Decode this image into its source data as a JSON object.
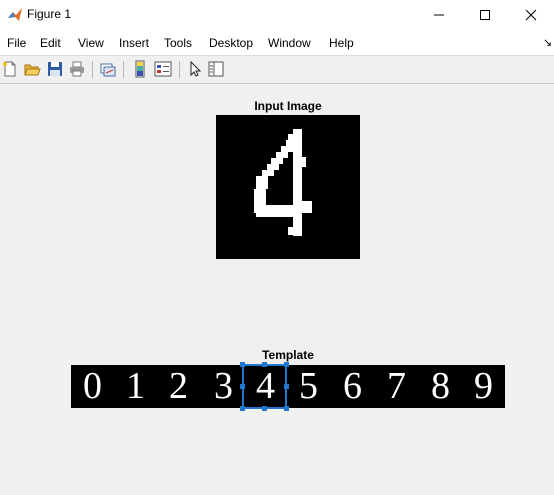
{
  "window": {
    "title": "Figure 1",
    "icons": {
      "app": "matlab-icon",
      "minimize": "minimize-icon",
      "maximize": "maximize-icon",
      "close": "close-icon"
    }
  },
  "menu": {
    "items": [
      "File",
      "Edit",
      "View",
      "Insert",
      "Tools",
      "Desktop",
      "Window",
      "Help"
    ],
    "dock_arrow": "↘"
  },
  "toolbar": {
    "icons": [
      "new-figure-icon",
      "open-file-icon",
      "save-icon",
      "print-icon",
      "link-plot-icon",
      "insert-colorbar-icon",
      "insert-legend-icon",
      "edit-plot-icon",
      "plot-browser-icon"
    ]
  },
  "axes": {
    "input_title": "Input Image",
    "template_title": "Template",
    "template_digits": [
      "0",
      "1",
      "2",
      "3",
      "4",
      "5",
      "6",
      "7",
      "8",
      "9"
    ],
    "selected_digit": "4",
    "colors": {
      "background": "#000000",
      "foreground": "#ffffff",
      "selection": "#1f77d0"
    }
  }
}
